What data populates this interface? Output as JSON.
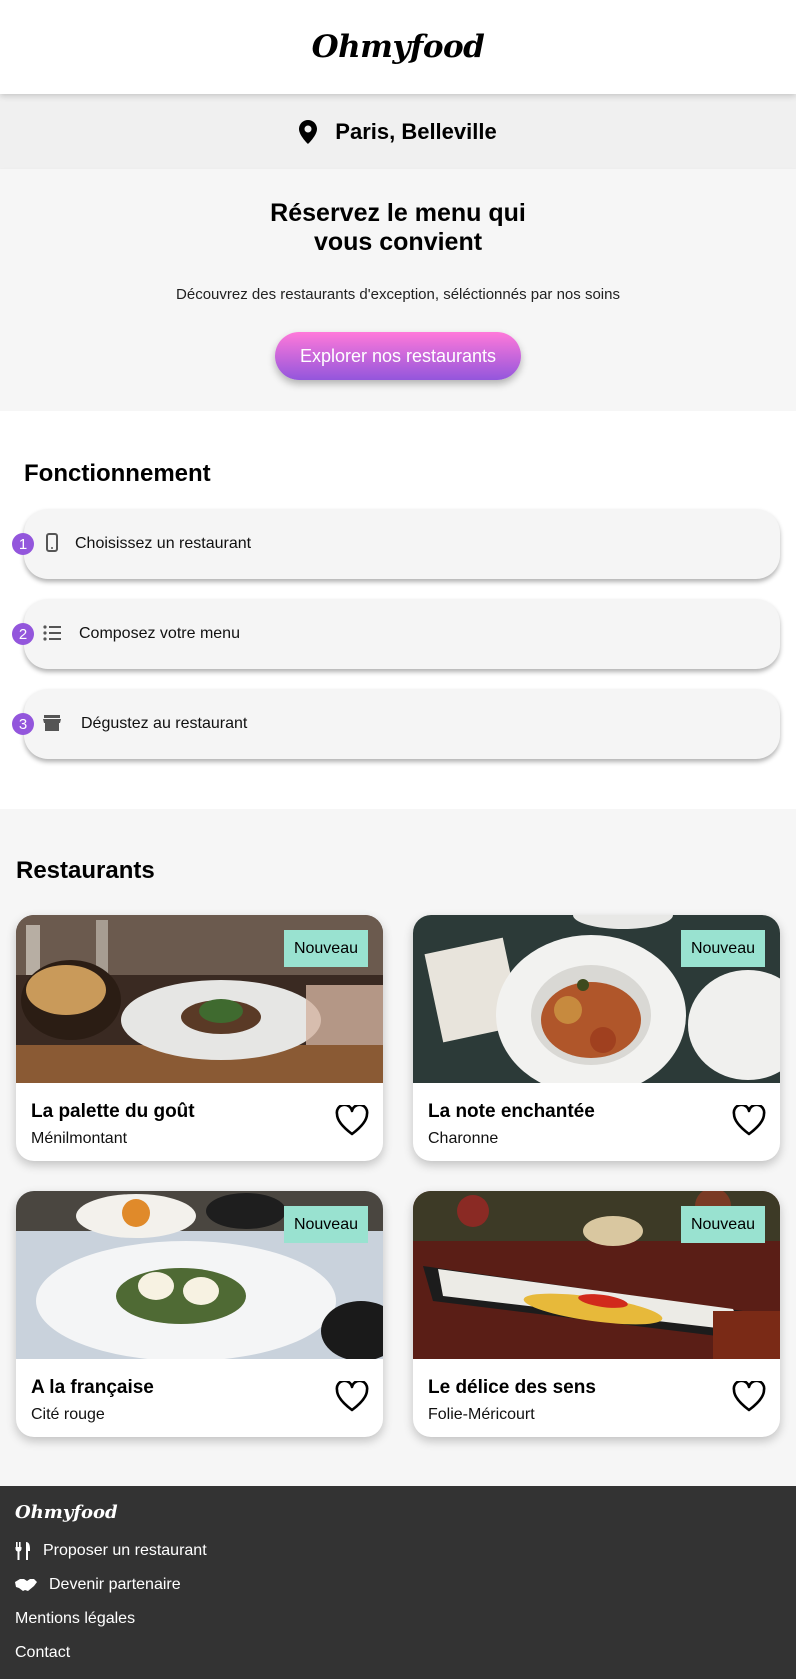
{
  "header": {
    "logo": "Ohmyfood"
  },
  "location": {
    "icon": "map-pin-icon",
    "text": "Paris, Belleville"
  },
  "hero": {
    "title_line1": "Réservez le menu qui",
    "title_line2": "vous convient",
    "subtitle": "Découvrez des restaurants d'exception, séléctionnés par nos soins",
    "button": "Explorer nos restaurants"
  },
  "how": {
    "title": "Fonctionnement",
    "steps": [
      {
        "num": "1",
        "icon": "phone-icon",
        "label": "Choisissez un restaurant"
      },
      {
        "num": "2",
        "icon": "list-icon",
        "label": "Composez votre menu"
      },
      {
        "num": "3",
        "icon": "store-icon",
        "label": "Dégustez au restaurant"
      }
    ]
  },
  "restaurants": {
    "title": "Restaurants",
    "badge": "Nouveau",
    "items": [
      {
        "name": "La palette du goût",
        "area": "Ménilmontant"
      },
      {
        "name": "La note enchantée",
        "area": "Charonne"
      },
      {
        "name": "A la française",
        "area": "Cité rouge"
      },
      {
        "name": "Le délice des sens",
        "area": "Folie-Méricourt"
      }
    ]
  },
  "footer": {
    "logo": "Ohmyfood",
    "links": [
      {
        "icon": "utensils-icon",
        "label": "Proposer un restaurant"
      },
      {
        "icon": "handshake-icon",
        "label": "Devenir partenaire"
      },
      {
        "label": "Mentions légales"
      },
      {
        "label": "Contact"
      }
    ]
  },
  "colors": {
    "accent_purple": "#9356dc",
    "accent_pink": "#ff79da",
    "badge": "#99e2d0",
    "footer": "#333333"
  }
}
